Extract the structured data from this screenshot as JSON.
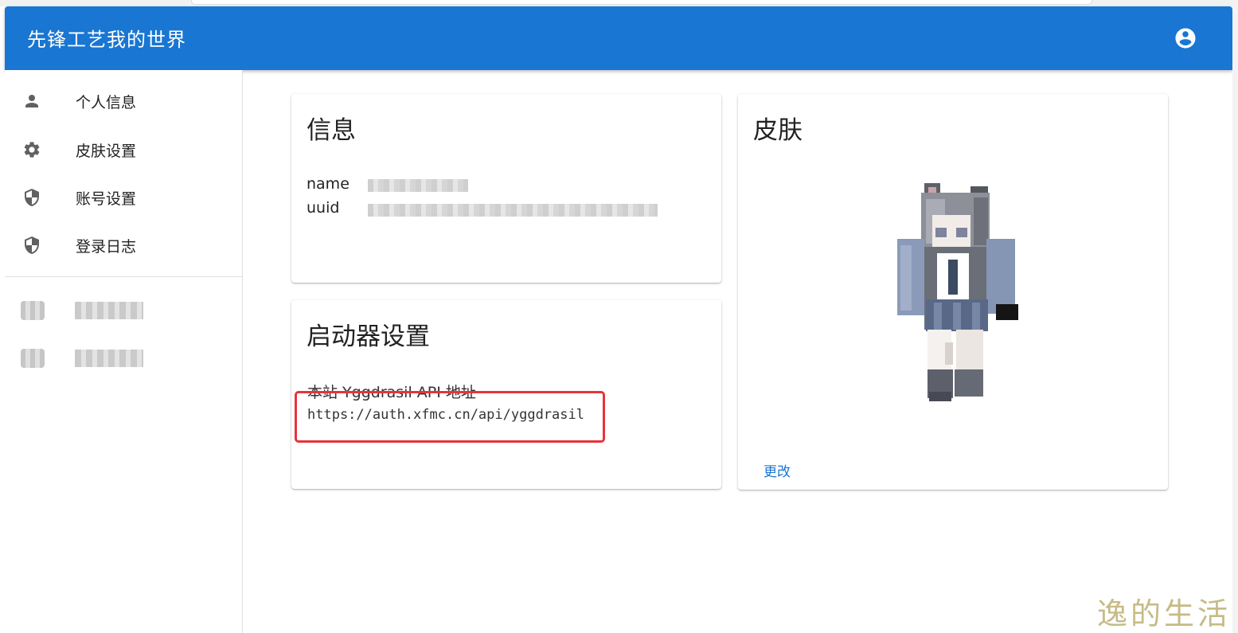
{
  "app": {
    "title": "先锋工艺我的世界"
  },
  "sidebar": {
    "items": [
      {
        "label": "个人信息",
        "icon": "person-icon"
      },
      {
        "label": "皮肤设置",
        "icon": "gear-icon"
      },
      {
        "label": "账号设置",
        "icon": "shield-icon"
      },
      {
        "label": "登录日志",
        "icon": "shield-icon"
      }
    ]
  },
  "info_card": {
    "title": "信息",
    "name_key": "name",
    "uuid_key": "uuid"
  },
  "launcher_card": {
    "title": "启动器设置",
    "api_label": "本站 Yggdrasil API 地址",
    "api_url": "https://auth.xfmc.cn/api/yggdrasil"
  },
  "skin_card": {
    "title": "皮肤",
    "change_label": "更改"
  },
  "watermark": "逸的生活",
  "colors": {
    "primary": "#1976d2",
    "highlight": "#e8333a"
  }
}
